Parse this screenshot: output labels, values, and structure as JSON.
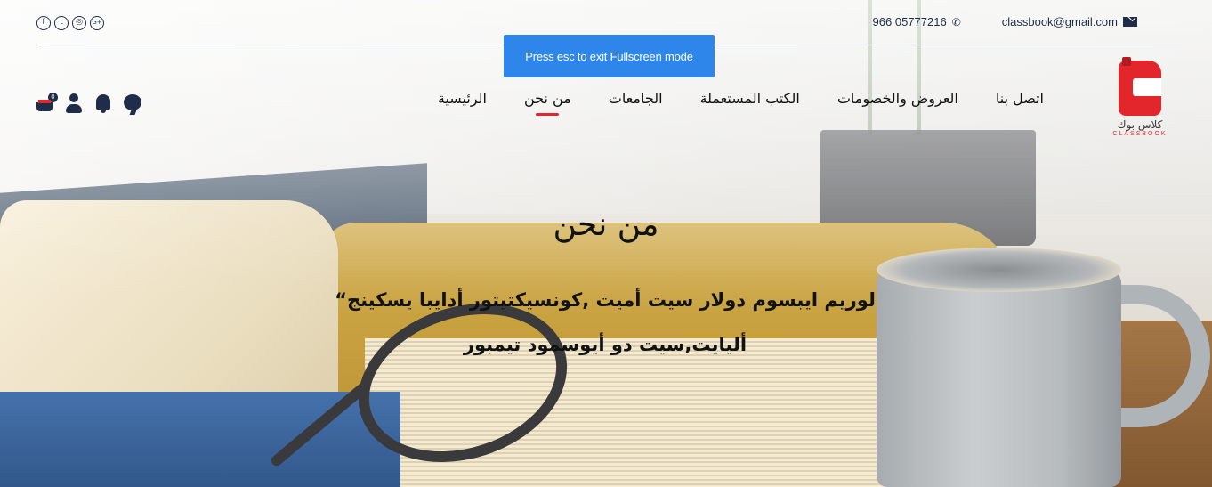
{
  "topbar": {
    "social_icons": [
      "facebook-icon",
      "twitter-icon",
      "instagram-icon",
      "google-plus-icon"
    ],
    "social_glyphs": [
      "f",
      "t",
      "◎",
      "G+"
    ],
    "email": "classbook@gmail.com",
    "phone": "966 05777216"
  },
  "toast": {
    "text": "Press esc to exit Fullscreen mode"
  },
  "logo": {
    "arabic": "كلاس بوك",
    "english": "CLASSBOOK"
  },
  "nav": {
    "items": [
      {
        "label": "الرئيسية"
      },
      {
        "label": "من نحن",
        "active": true
      },
      {
        "label": "الجامعات"
      },
      {
        "label": "الكتب المستعملة"
      },
      {
        "label": "العروض والخصومات"
      },
      {
        "label": "اتصل بنا"
      }
    ]
  },
  "header_icons": {
    "cart_count": "0"
  },
  "hero": {
    "title": "من نحن",
    "line1": "لوريم ايبسوم دولار سيت أميت ,كونسيكتيتور أدايبا يسكينج“",
    "line2": "أليايت,سيت دو أيوسمود تيمبور"
  },
  "colors": {
    "accent": "#e3262c",
    "navy": "#1f2d4a",
    "toast": "#2e86ea"
  }
}
